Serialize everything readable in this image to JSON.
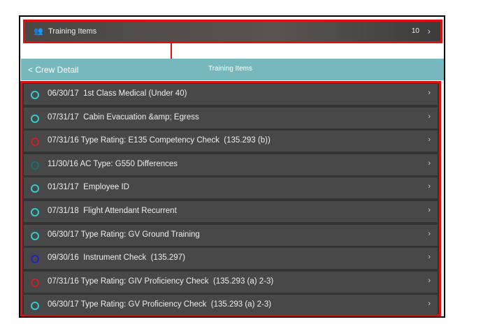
{
  "top_bar": {
    "icon": "people-icon",
    "label": "Training Items",
    "count": "10"
  },
  "nav": {
    "back_label": "< Crew Detail",
    "title": "Training Items"
  },
  "items": [
    {
      "text": "06/30/17  1st Class Medical (Under 40)",
      "status_color": "#33cccc"
    },
    {
      "text": "07/31/17  Cabin Evacuation &amp; Egress",
      "status_color": "#33cccc"
    },
    {
      "text": "07/31/16 Type Rating: E135 Competency Check  (135.293 (b))",
      "status_color": "#cc2222"
    },
    {
      "text": "11/30/16 AC Type: G550 Differences",
      "status_color": "#1a7070"
    },
    {
      "text": "01/31/17  Employee ID",
      "status_color": "#33cccc"
    },
    {
      "text": "07/31/18  Flight Attendant Recurrent",
      "status_color": "#33cccc"
    },
    {
      "text": "06/30/17 Type Rating: GV Ground Training",
      "status_color": "#33cccc"
    },
    {
      "text": "09/30/16  Instrument Check  (135.297)",
      "status_color": "#2222bb"
    },
    {
      "text": "07/31/16 Type Rating: GIV Proficiency Check  (135.293 (a) 2-3)",
      "status_color": "#cc2222"
    },
    {
      "text": "06/30/17 Type Rating: GV Proficiency Check  (135.293 (a) 2-3)",
      "status_color": "#33cccc"
    }
  ]
}
